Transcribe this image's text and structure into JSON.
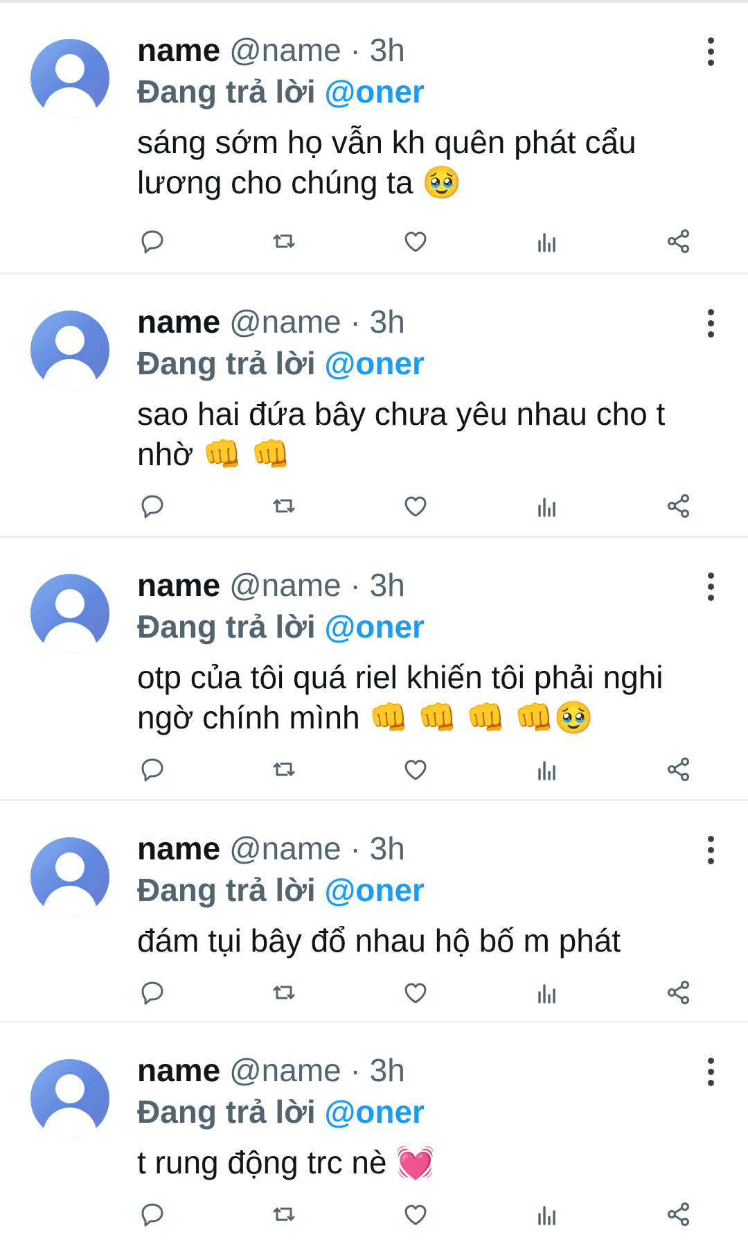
{
  "colors": {
    "accent": "#1d9bf0",
    "muted": "#536471",
    "text": "#0f1419"
  },
  "tweets": [
    {
      "name": "name",
      "handle": "@name",
      "dot": "·",
      "time": "3h",
      "reply_prefix": "Đang trả lời",
      "reply_to": "@oner",
      "text": "sáng sớm họ vẫn kh quên phát cẩu lương cho chúng ta 🥹"
    },
    {
      "name": "name",
      "handle": "@name",
      "dot": "·",
      "time": "3h",
      "reply_prefix": "Đang trả lời",
      "reply_to": "@oner",
      "text": "sao hai đứa bây chưa yêu nhau cho t nhờ 👊 👊"
    },
    {
      "name": "name",
      "handle": "@name",
      "dot": "·",
      "time": "3h",
      "reply_prefix": "Đang trả lời",
      "reply_to": "@oner",
      "text": "otp của tôi quá riel khiến tôi phải nghi ngờ chính mình 👊 👊 👊 👊🥹"
    },
    {
      "name": "name",
      "handle": "@name",
      "dot": "·",
      "time": "3h",
      "reply_prefix": "Đang trả lời",
      "reply_to": "@oner",
      "text": "đám tụi bây đổ nhau hộ bố m phát"
    },
    {
      "name": "name",
      "handle": "@name",
      "dot": "·",
      "time": "3h",
      "reply_prefix": "Đang trả lời",
      "reply_to": "@oner",
      "text": "t rung động trc nè 💓"
    }
  ],
  "action_icons": [
    "reply-icon",
    "retweet-icon",
    "like-icon",
    "analytics-icon",
    "share-icon"
  ]
}
